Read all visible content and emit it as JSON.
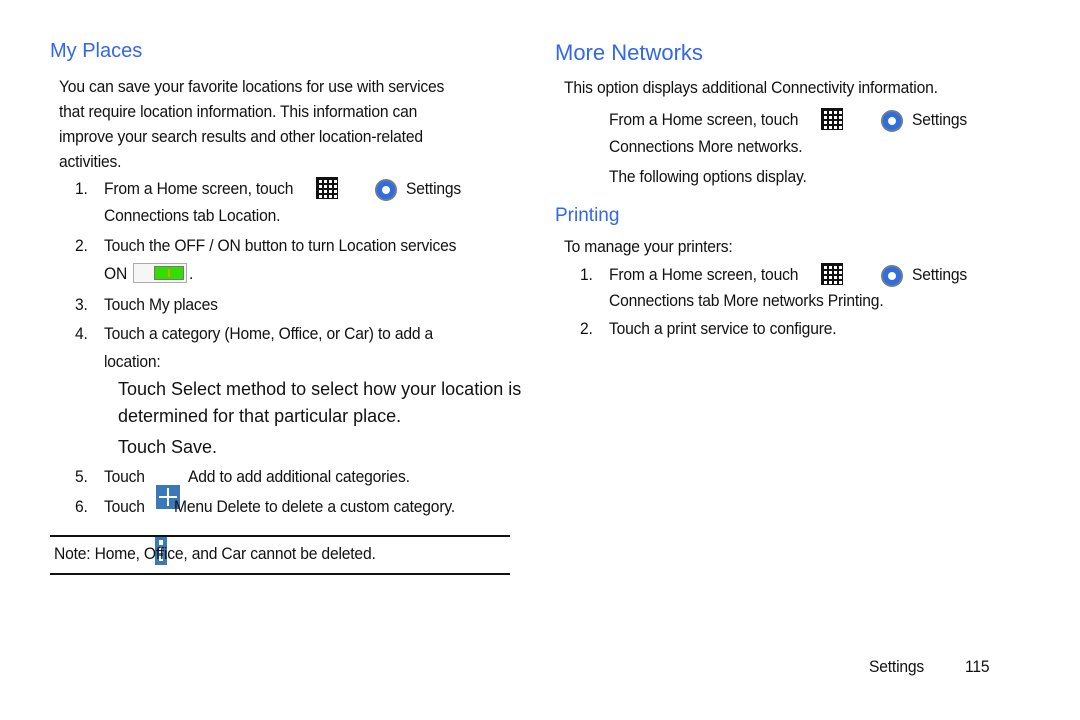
{
  "left": {
    "heading": "My Places",
    "intro": [
      "You can save your favorite locations for use with services",
      "that require location information. This information can",
      "improve your search results and other location-related",
      "activities."
    ],
    "steps": [
      {
        "num": "1.",
        "line1a": "From a Home screen, touch",
        "line1b": "Settings",
        "line2": "Connections tab     Location."
      },
      {
        "num": "2.",
        "line1": "Touch the OFF / ON button to turn Location services",
        "line2": "ON",
        "line2_end": "."
      },
      {
        "num": "3.",
        "line1": "Touch My places"
      },
      {
        "num": "4.",
        "line1": "Touch a category (Home, Office, or Car) to add a",
        "line2": "location:"
      },
      {
        "num": "5.",
        "pre": "Touch",
        "post": "Add to add additional categories."
      },
      {
        "num": "6.",
        "pre": "Touch",
        "post": "Menu     Delete to delete a custom category."
      }
    ],
    "substeps": [
      "Touch Select method to select how your location is",
      "determined for that particular place.",
      "Touch Save."
    ],
    "note": "Note: Home, Office, and Car cannot be deleted."
  },
  "right": {
    "heading": "More Networks",
    "intro": "This option displays additional Connectivity information.",
    "step_a1": "From a Home screen, touch",
    "step_a1b": "Settings",
    "step_a2": "Connections     More networks.",
    "step_b": "The following options display.",
    "subheading": "Printing",
    "printing_intro": "To manage your printers:",
    "printing_steps": [
      {
        "num": "1.",
        "line1a": "From a Home screen, touch",
        "line1b": "Settings",
        "line2": "Connections tab     More networks     Printing."
      },
      {
        "num": "2.",
        "line1": "Touch a print service to configure."
      }
    ]
  },
  "footer": {
    "section": "Settings",
    "page": "115"
  },
  "colors": {
    "heading": "#3366ee",
    "gear": "#2f6de0",
    "toggle_on": "#33dd00",
    "action_icon": "#3a78b8"
  }
}
